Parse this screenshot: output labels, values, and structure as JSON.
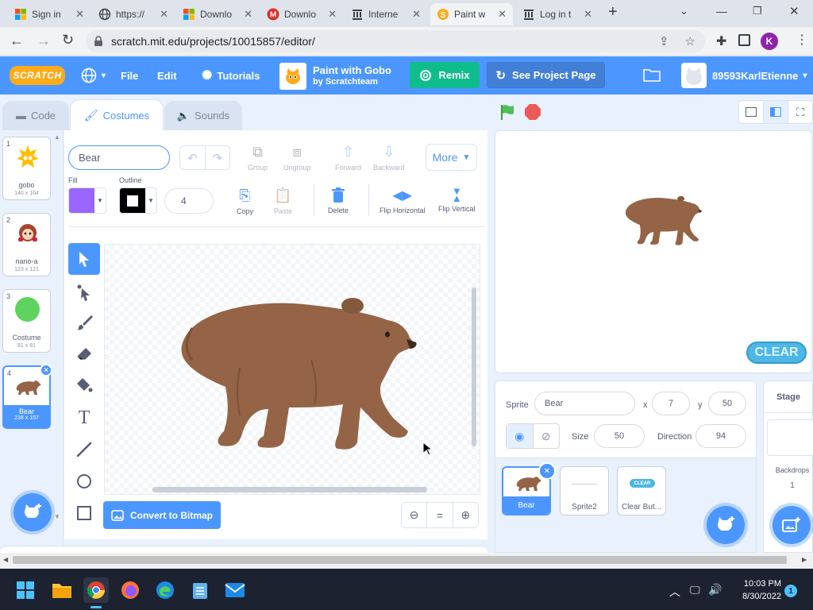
{
  "browser": {
    "tabs": [
      {
        "label": "Sign in"
      },
      {
        "label": "https://"
      },
      {
        "label": "Downlo"
      },
      {
        "label": "Downlo"
      },
      {
        "label": "Interne"
      },
      {
        "label": "Paint w"
      },
      {
        "label": "Log in t"
      }
    ],
    "url": "scratch.mit.edu/projects/10015857/editor/",
    "profile_initial": "K"
  },
  "menubar": {
    "logo": "SCRATCH",
    "file": "File",
    "edit": "Edit",
    "tutorials": "Tutorials",
    "project_title": "Paint with Gobo",
    "project_author": "by Scratchteam",
    "remix": "Remix",
    "see_project_page": "See Project Page",
    "username": "89593KarlEtienne"
  },
  "editor_tabs": {
    "code": "Code",
    "costumes": "Costumes",
    "sounds": "Sounds"
  },
  "costumes": [
    {
      "num": "1",
      "name": "gobo",
      "size": "140 x 164"
    },
    {
      "num": "2",
      "name": "nano-a",
      "size": "123 x 121"
    },
    {
      "num": "3",
      "name": "Costume",
      "size": "81 x 81"
    },
    {
      "num": "4",
      "name": "Bear",
      "size": "238 x 157"
    }
  ],
  "paint": {
    "costume_name": "Bear",
    "group": "Group",
    "ungroup": "Ungroup",
    "forward": "Forward",
    "backward": "Backward",
    "more": "More",
    "fill_label": "Fill",
    "outline_label": "Outline",
    "outline_width": "4",
    "copy": "Copy",
    "paste": "Paste",
    "delete": "Delete",
    "flip_h": "Flip Horizontal",
    "flip_v": "Flip Vertical",
    "convert": "Convert to Bitmap",
    "fill_color": "#9966ff",
    "outline_color": "#000000"
  },
  "stage": {
    "clear_label": "CLEAR"
  },
  "sprite_info": {
    "sprite_label": "Sprite",
    "sprite_name": "Bear",
    "x_label": "x",
    "x": "7",
    "y_label": "y",
    "y": "50",
    "size_label": "Size",
    "size": "50",
    "direction_label": "Direction",
    "direction": "94"
  },
  "sprites": [
    {
      "name": "Bear"
    },
    {
      "name": "Sprite2"
    },
    {
      "name": "Clear But..."
    }
  ],
  "clear_thumb": "CLEAR",
  "stage_pane": {
    "title": "Stage",
    "backdrops_label": "Backdrops",
    "backdrops_count": "1"
  },
  "taskbar": {
    "time": "10:03 PM",
    "date": "8/30/2022",
    "notifications": "1"
  }
}
